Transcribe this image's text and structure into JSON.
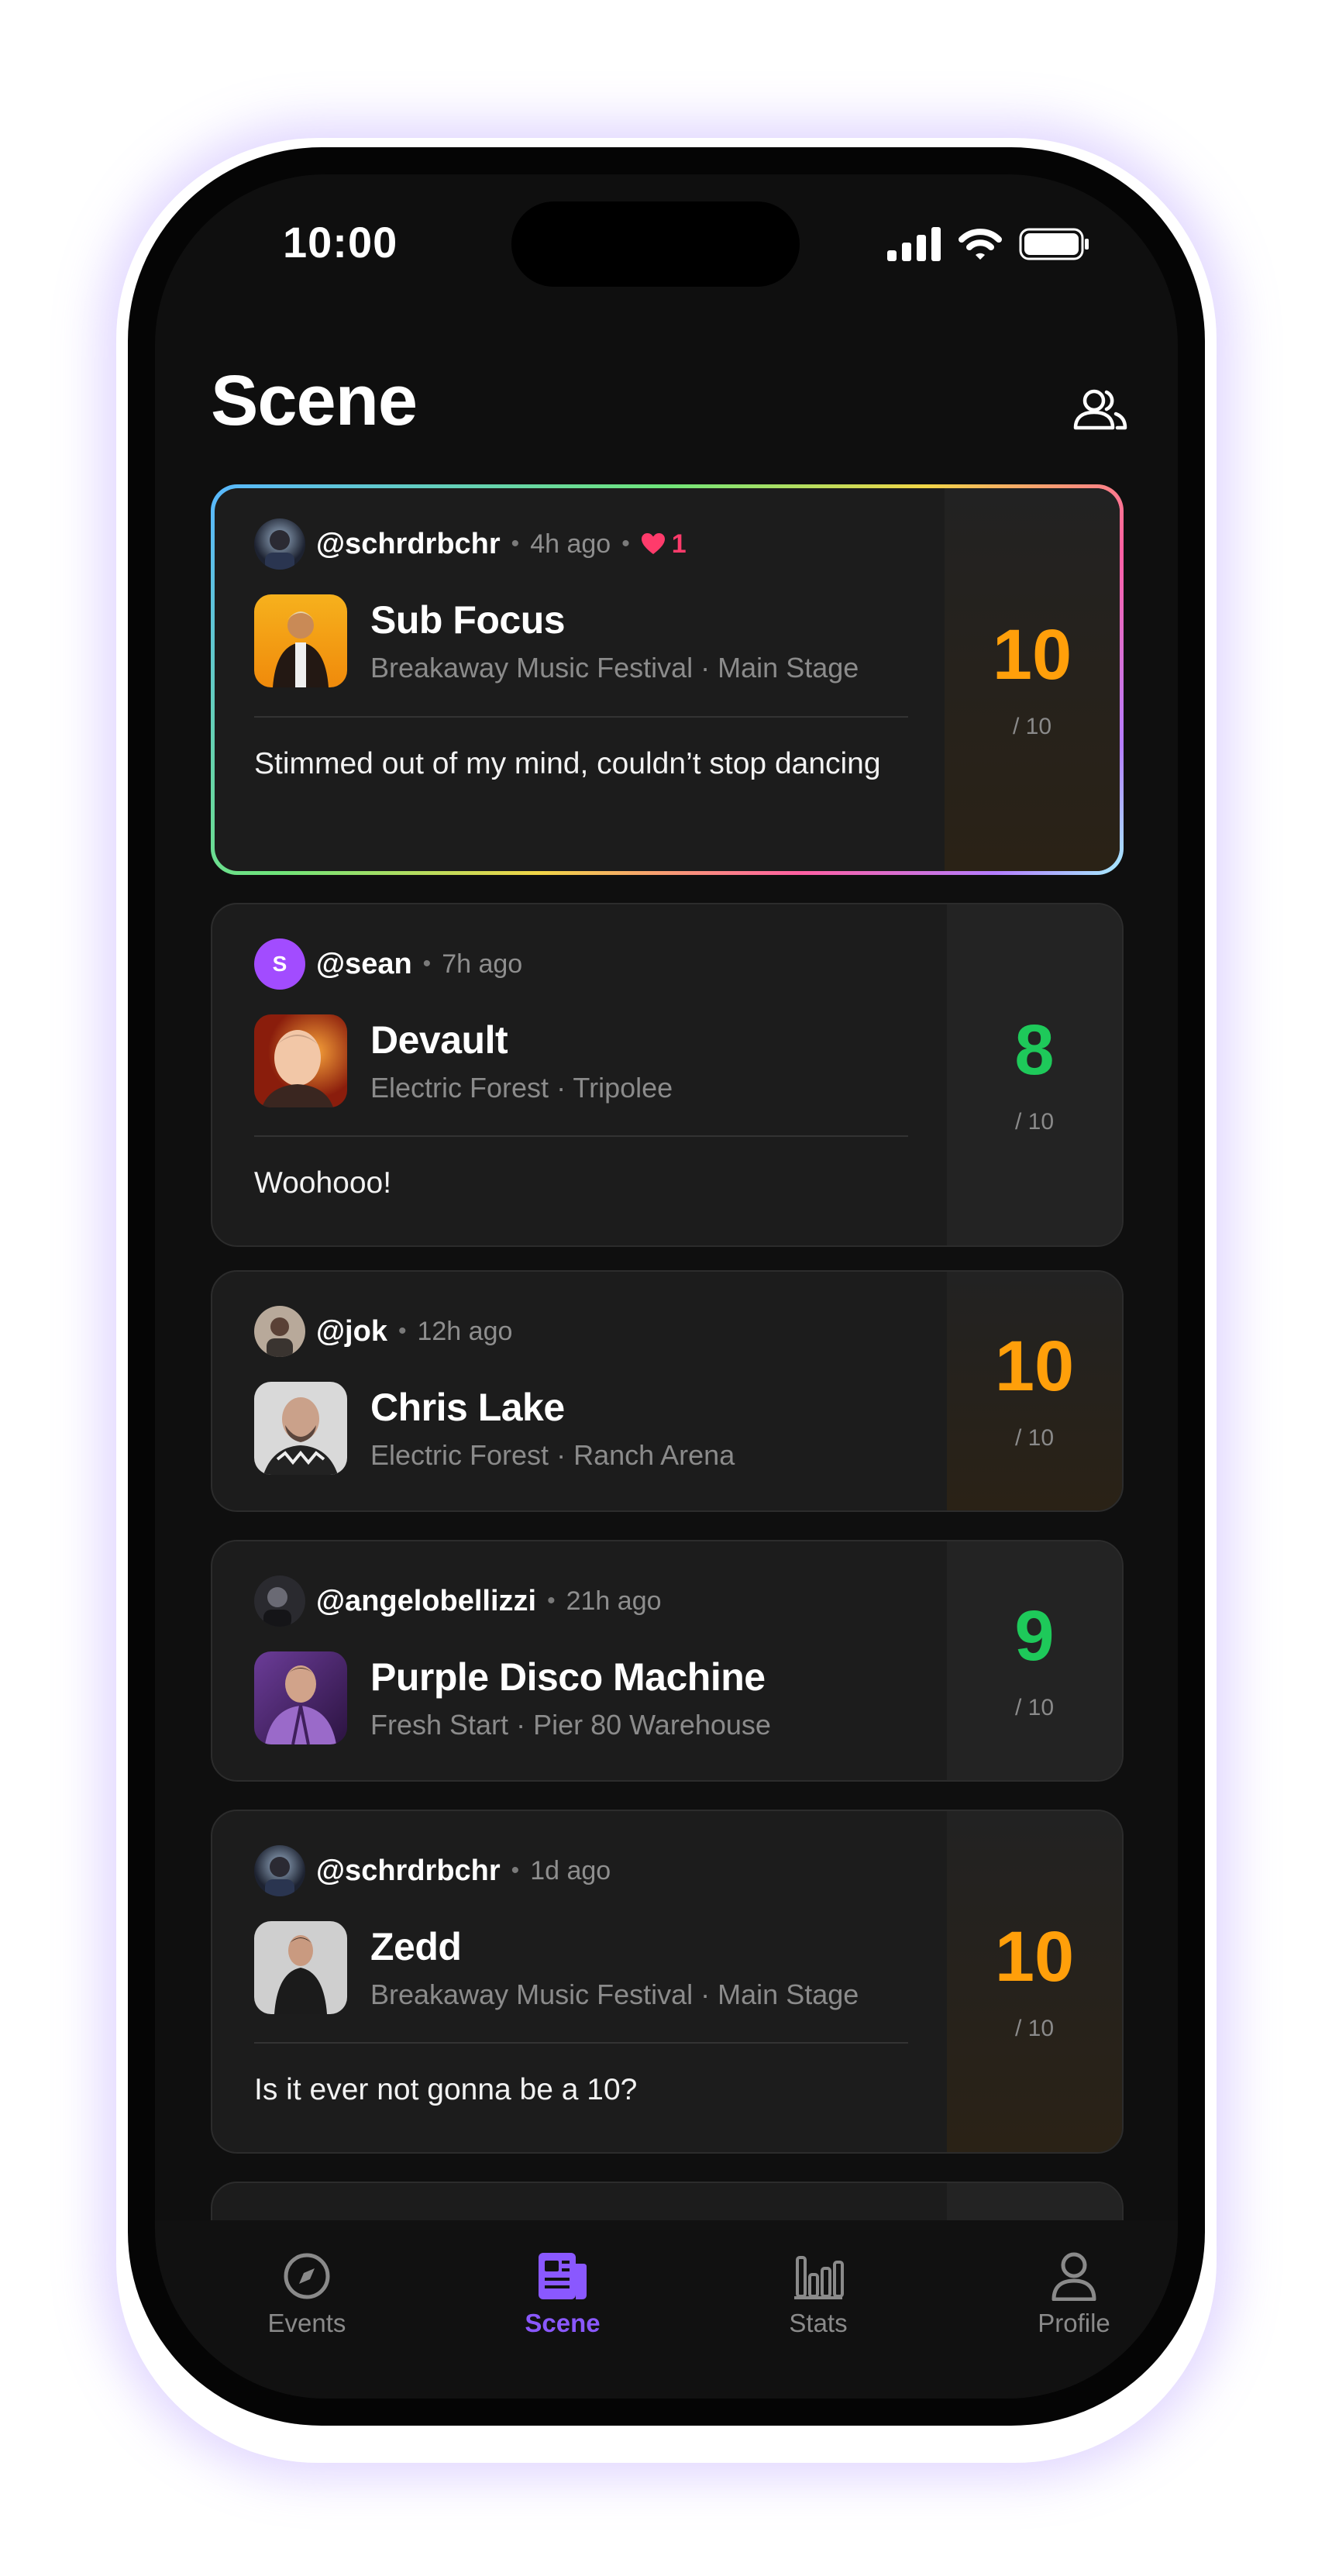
{
  "status_bar": {
    "time": "10:00"
  },
  "header": {
    "title": "Scene",
    "friends_icon": "people-icon"
  },
  "colors": {
    "score_gold": "#ff9f0a",
    "score_green": "#1ec95a",
    "like": "#ff3b6b",
    "accent": "#8a58ff",
    "avatar_letter_bg": "#a24cff"
  },
  "feed": [
    {
      "username": "@schrdrbchr",
      "ago": "4h ago",
      "likes": "1",
      "artist": "Sub Focus",
      "festival": "Breakaway Music Festival",
      "stage": "Main Stage",
      "comment": "Stimmed out of my mind, couldn’t stop dancing",
      "score": "10",
      "out_of": "/ 10"
    },
    {
      "username": "@sean",
      "avatar_letter": "S",
      "ago": "7h ago",
      "artist": "Devault",
      "festival": "Electric Forest",
      "stage": "Tripolee",
      "comment": "Woohooo!",
      "score": "8",
      "out_of": "/ 10"
    },
    {
      "username": "@jok",
      "ago": "12h ago",
      "artist": "Chris Lake",
      "festival": "Electric Forest",
      "stage": "Ranch Arena",
      "score": "10",
      "out_of": "/ 10"
    },
    {
      "username": "@angelobellizzi",
      "ago": "21h ago",
      "artist": "Purple Disco Machine",
      "festival": "Fresh Start",
      "stage": "Pier 80 Warehouse",
      "score": "9",
      "out_of": "/ 10"
    },
    {
      "username": "@schrdrbchr",
      "ago": "1d ago",
      "artist": "Zedd",
      "festival": "Breakaway Music Festival",
      "stage": "Main Stage",
      "comment": "Is it ever not gonna be a 10?",
      "score": "10",
      "out_of": "/ 10"
    }
  ],
  "separator": "·",
  "dot": "•",
  "tabbar": [
    {
      "label": "Events",
      "icon": "compass-icon",
      "active": false
    },
    {
      "label": "Scene",
      "icon": "newspaper-icon",
      "active": true
    },
    {
      "label": "Stats",
      "icon": "bar-chart-icon",
      "active": false
    },
    {
      "label": "Profile",
      "icon": "person-icon",
      "active": false
    }
  ]
}
